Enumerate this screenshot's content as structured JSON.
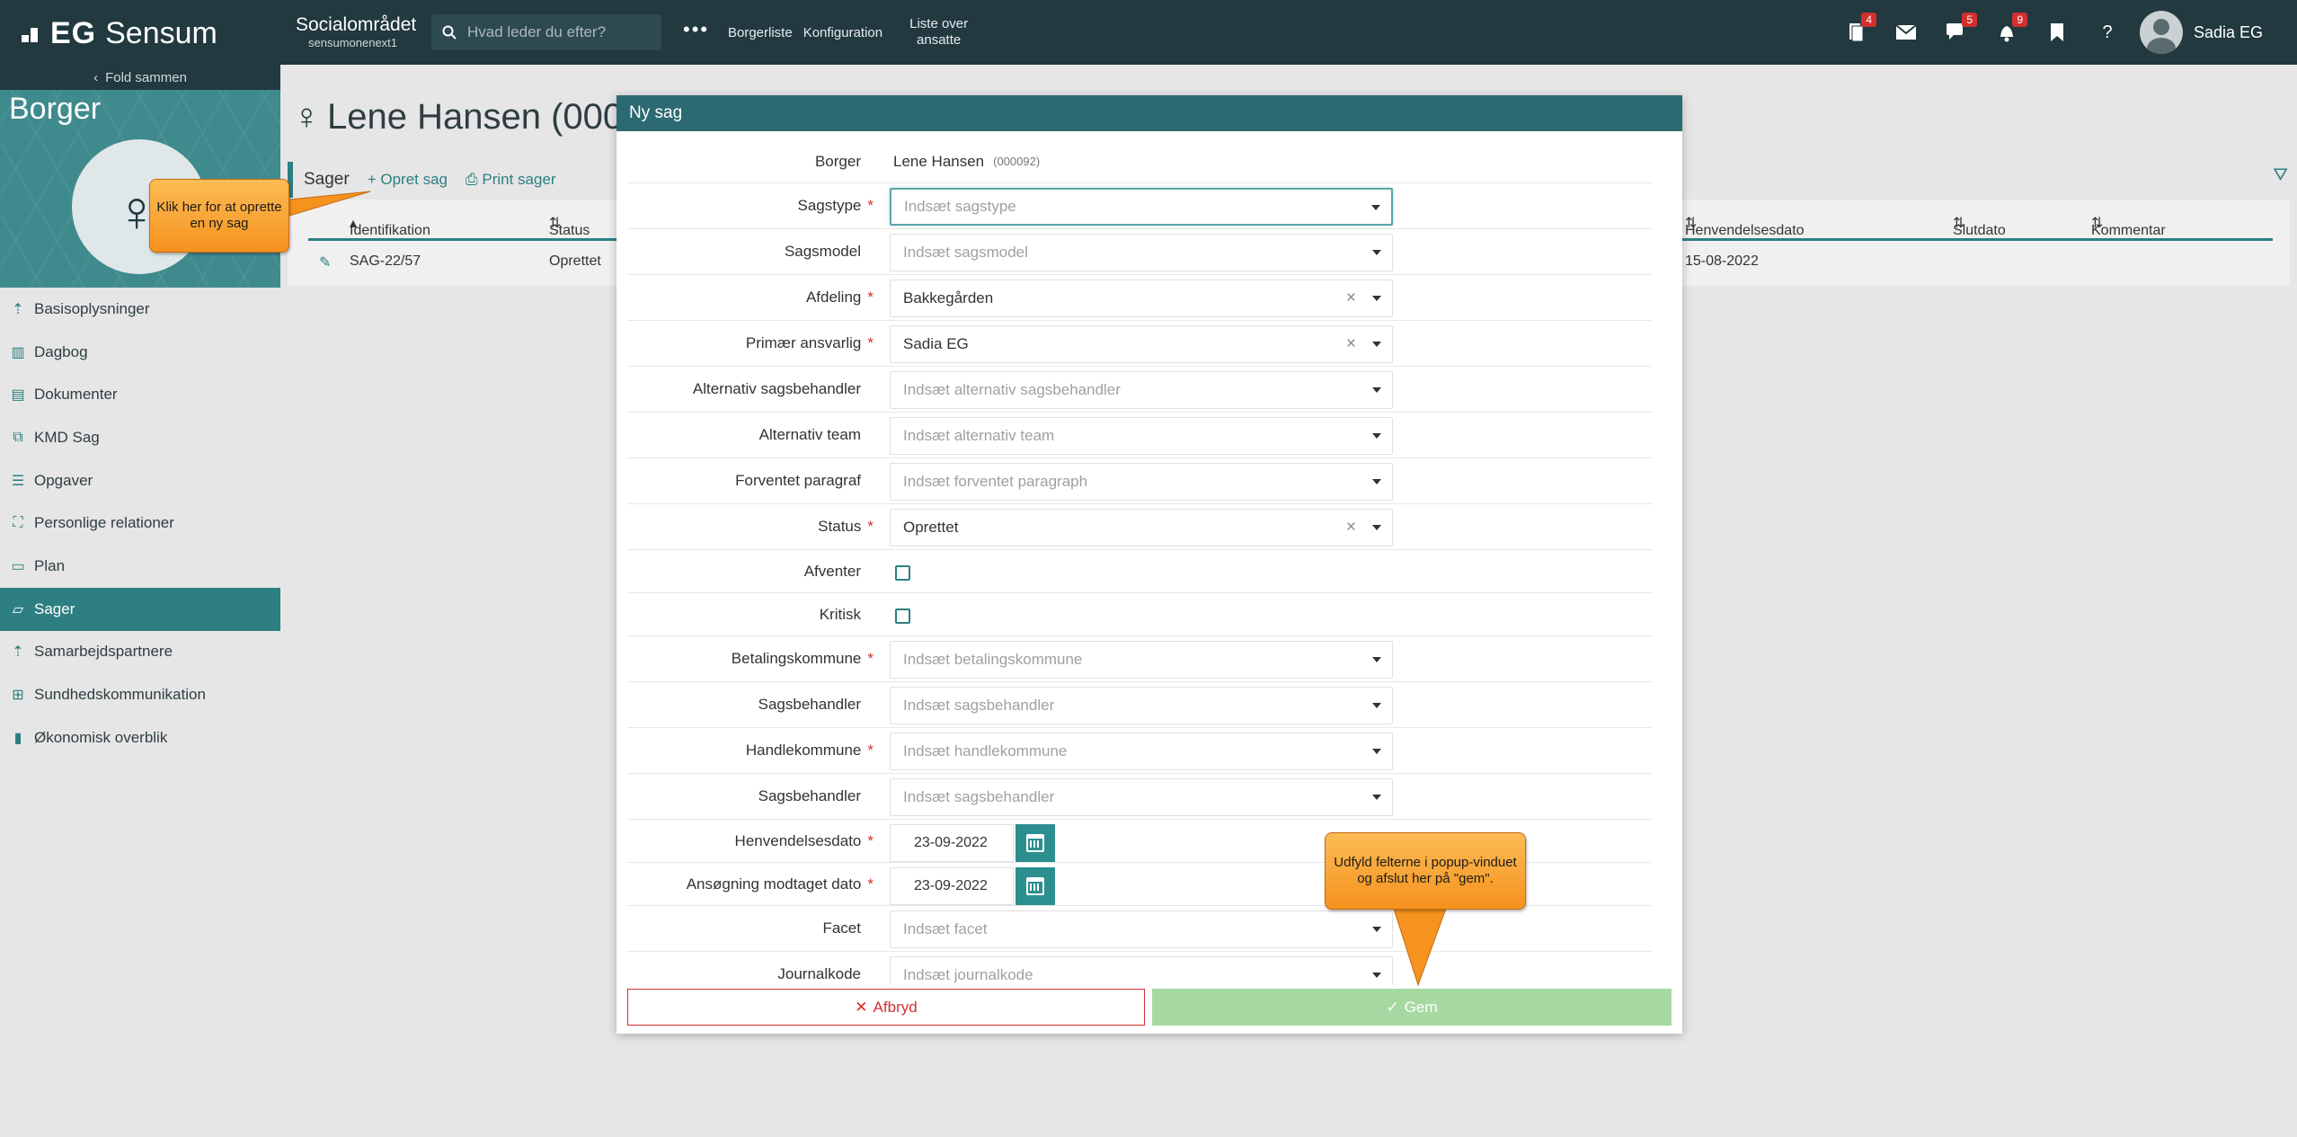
{
  "app": {
    "brand_bold": "EG",
    "brand_rest": "Sensum",
    "area_title": "Socialområdet",
    "area_sub": "sensumonenext1",
    "search_placeholder": "Hvad leder du efter?",
    "more": "•••",
    "nav": [
      "Borgerliste",
      "Konfiguration"
    ],
    "nav_two_line": [
      "Liste over",
      "ansatte"
    ],
    "badges": {
      "documents": "4",
      "chat": "5",
      "bell": "9"
    },
    "user_name": "Sadia EG"
  },
  "sidebar": {
    "fold_label": "Fold sammen",
    "hero_title": "Borger",
    "items": [
      {
        "label": "Basisoplysninger",
        "icon": "person-icon"
      },
      {
        "label": "Dagbog",
        "icon": "book-icon"
      },
      {
        "label": "Dokumenter",
        "icon": "document-icon"
      },
      {
        "label": "KMD Sag",
        "icon": "link-icon"
      },
      {
        "label": "Opgaver",
        "icon": "list-icon"
      },
      {
        "label": "Personlige relationer",
        "icon": "relations-icon"
      },
      {
        "label": "Plan",
        "icon": "clipboard-icon"
      },
      {
        "label": "Sager",
        "icon": "folder-icon"
      },
      {
        "label": "Samarbejdspartnere",
        "icon": "person-icon"
      },
      {
        "label": "Sundhedskommunikation",
        "icon": "health-icon"
      },
      {
        "label": "Økonomisk overblik",
        "icon": "money-icon"
      }
    ],
    "active_index": 7
  },
  "main": {
    "person_name": "Lene Hansen (0000",
    "cases_label": "Sager",
    "create_case": "+ Opret sag",
    "print_cases": "Print sager",
    "columns": {
      "id": "Identifikation",
      "status": "Status",
      "inquiry_date": "Henvendelsesdato",
      "end_date": "Slutdato",
      "comment": "Kommentar"
    },
    "row": {
      "id": "SAG-22/57",
      "status": "Oprettet",
      "inquiry_date": "15-08-2022"
    }
  },
  "modal": {
    "title": "Ny sag",
    "citizen_label": "Borger",
    "citizen_name": "Lene Hansen",
    "citizen_id": "(000092)",
    "fields": {
      "sagstype": {
        "label": "Sagstype",
        "placeholder": "Indsæt sagstype"
      },
      "sagsmodel": {
        "label": "Sagsmodel",
        "placeholder": "Indsæt sagsmodel"
      },
      "afdeling": {
        "label": "Afdeling",
        "value": "Bakkegården"
      },
      "primaer": {
        "label": "Primær ansvarlig",
        "value": "Sadia EG"
      },
      "alt_sagsbehandler": {
        "label": "Alternativ sagsbehandler",
        "placeholder": "Indsæt alternativ sagsbehandler"
      },
      "alt_team": {
        "label": "Alternativ team",
        "placeholder": "Indsæt alternativ team"
      },
      "paragraf": {
        "label": "Forventet paragraf",
        "placeholder": "Indsæt forventet paragraph"
      },
      "status": {
        "label": "Status",
        "value": "Oprettet"
      },
      "afventer": {
        "label": "Afventer"
      },
      "kritisk": {
        "label": "Kritisk"
      },
      "betalingskommune": {
        "label": "Betalingskommune",
        "placeholder": "Indsæt betalingskommune"
      },
      "sagsbehandler1": {
        "label": "Sagsbehandler",
        "placeholder": "Indsæt sagsbehandler"
      },
      "handlekommune": {
        "label": "Handlekommune",
        "placeholder": "Indsæt handlekommune"
      },
      "sagsbehandler2": {
        "label": "Sagsbehandler",
        "placeholder": "Indsæt sagsbehandler"
      },
      "henvendelsesdato": {
        "label": "Henvendelsesdato",
        "value": "23-09-2022"
      },
      "ansoegning": {
        "label": "Ansøgning modtaget dato",
        "value": "23-09-2022"
      },
      "facet": {
        "label": "Facet",
        "placeholder": "Indsæt facet"
      },
      "journalkode": {
        "label": "Journalkode",
        "placeholder": "Indsæt journalkode"
      }
    },
    "cancel_label": "Afbryd",
    "save_label": "Gem"
  },
  "callouts": {
    "create": "Klik her for at oprette en ny sag",
    "save": "Udfyld felterne i popup-vinduet og afslut her på \"gem\"."
  },
  "colors": {
    "topbar": "#21393f",
    "accent": "#2d7f82",
    "required": "#d32f2f",
    "save_disabled": "#a6d9a1",
    "callout": "#f6921e"
  }
}
